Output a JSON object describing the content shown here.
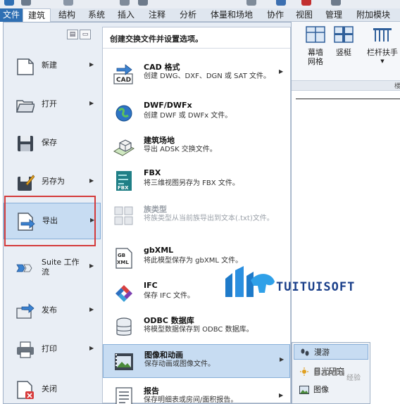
{
  "ribbon_tabs": [
    "文件",
    "建筑",
    "结构",
    "系统",
    "插入",
    "注释",
    "分析",
    "体量和场地",
    "协作",
    "视图",
    "管理",
    "附加模块"
  ],
  "active_tab": "建筑",
  "ribbon": {
    "buttons": [
      {
        "label": "幕墙\n网格",
        "label_l1": "幕墙",
        "label_l2": "网格"
      },
      {
        "label": "竖梃"
      },
      {
        "label": "栏杆扶手"
      }
    ],
    "panel_label": "楼"
  },
  "app_menu": {
    "left_items": [
      {
        "label": "新建",
        "icon": "new-document-icon",
        "has_arrow": true
      },
      {
        "label": "打开",
        "icon": "open-folder-icon",
        "has_arrow": true
      },
      {
        "label": "保存",
        "icon": "save-disk-icon",
        "has_arrow": false
      },
      {
        "label": "另存为",
        "icon": "save-as-icon",
        "has_arrow": true
      },
      {
        "label": "导出",
        "icon": "export-icon",
        "has_arrow": true,
        "active": true
      },
      {
        "label": "Suite 工作流",
        "label_l1": "Suite 工作",
        "label_l2": "流",
        "icon": "suite-workflow-icon",
        "has_arrow": true
      },
      {
        "label": "发布",
        "icon": "publish-icon",
        "has_arrow": true
      },
      {
        "label": "打印",
        "icon": "printer-icon",
        "has_arrow": true
      },
      {
        "label": "关闭",
        "icon": "close-document-icon",
        "has_arrow": false
      }
    ],
    "panel_header": "创建交换文件并设置选项。",
    "export_items": [
      {
        "title": "CAD 格式",
        "desc": "创建 DWG、DXF、DGN 或 SAT 文件。",
        "icon": "cad-icon",
        "has_arrow": true
      },
      {
        "title": "DWF/DWFx",
        "desc": "创建 DWF 或 DWFx 文件。",
        "icon": "dwf-globe-icon",
        "has_arrow": false
      },
      {
        "title": "建筑场地",
        "desc": "导出 ADSK 交换文件。",
        "icon": "building-site-icon",
        "has_arrow": false
      },
      {
        "title": "FBX",
        "desc": "将三维视图另存为 FBX 文件。",
        "icon": "fbx-icon",
        "has_arrow": false
      },
      {
        "title": "族类型",
        "desc": "将族类型从当前族导出到文本(.txt)文件。",
        "icon": "family-types-icon",
        "has_arrow": false,
        "disabled": true
      },
      {
        "title": "gbXML",
        "desc": "将此模型保存为 gbXML 文件。",
        "icon": "gbxml-icon",
        "has_arrow": false
      },
      {
        "title": "IFC",
        "desc": "保存 IFC 文件。",
        "icon": "ifc-icon",
        "has_arrow": false
      },
      {
        "title": "ODBC 数据库",
        "desc": "将模型数据保存到 ODBC 数据库。",
        "icon": "database-icon",
        "has_arrow": false
      },
      {
        "title": "图像和动画",
        "desc": "保存动画或图像文件。",
        "icon": "film-image-icon",
        "has_arrow": true,
        "active": true
      },
      {
        "title": "报告",
        "desc": "保存明细表或房间/面积报告。",
        "icon": "report-icon",
        "has_arrow": true
      }
    ]
  },
  "submenu": {
    "items": [
      {
        "label": "漫游",
        "icon": "walkthrough-icon",
        "highlighted": true
      },
      {
        "label": "日光研究",
        "icon": "sun-study-icon"
      },
      {
        "label": "图像",
        "icon": "image-icon"
      }
    ]
  },
  "watermark": {
    "text": "TUITUISOFT",
    "baidu": "Baidu",
    "baidu_suffix": "经验"
  },
  "colors": {
    "accent": "#2f6fb3",
    "highlight": "#c7dcf2",
    "highlight_border": "#86aed8",
    "red_box": "#d43a3a"
  }
}
